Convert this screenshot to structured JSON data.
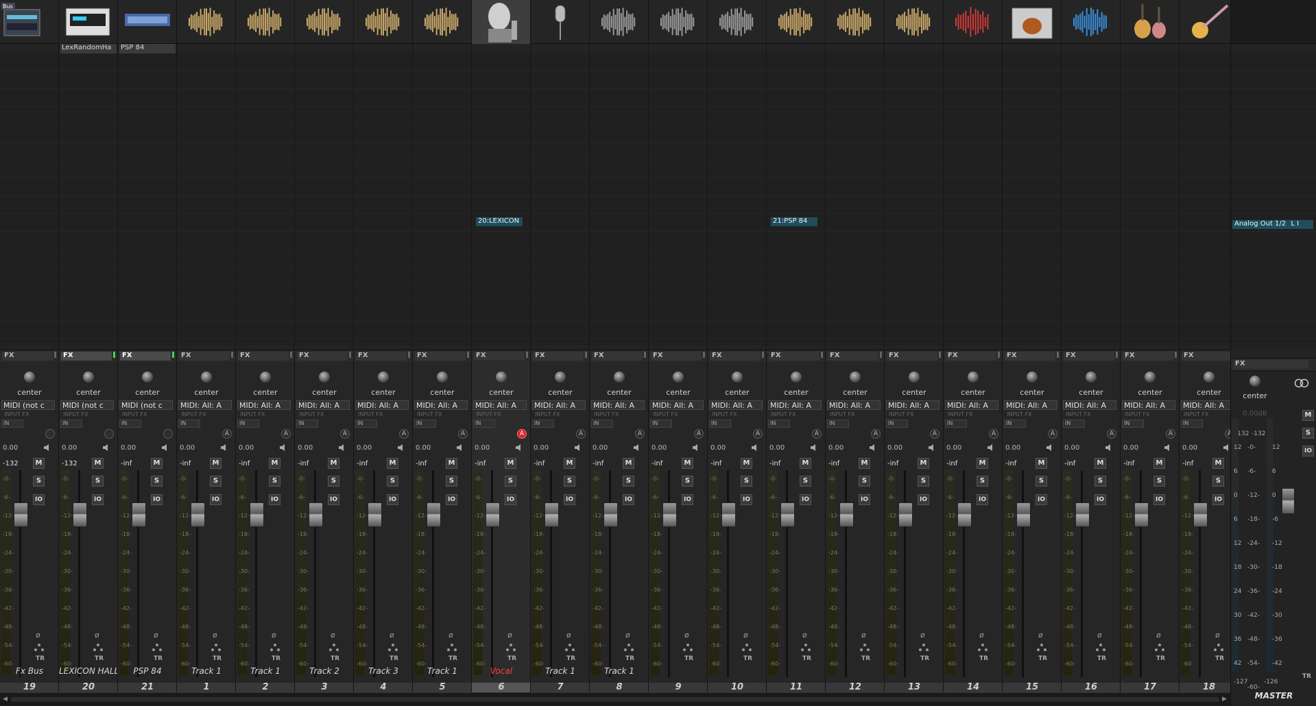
{
  "tracks": [
    {
      "num": "19",
      "name": "Fx Bus",
      "pan": "center",
      "input": "MIDI (not c",
      "volume": "0.00",
      "peak": "-132",
      "fx_on": false,
      "fx_led": false,
      "icon": "rack-device-icon",
      "send": "",
      "arm": "none",
      "selected": false,
      "tab": ""
    },
    {
      "num": "20",
      "name": "LEXICON HALL",
      "pan": "center",
      "input": "MIDI (not c",
      "volume": "0.00",
      "peak": "-132",
      "fx_on": true,
      "fx_led": true,
      "icon": "lexicon-hardware-icon",
      "send": "",
      "arm": "none",
      "selected": false,
      "tab": "LexRandomHa"
    },
    {
      "num": "21",
      "name": "PSP 84",
      "pan": "center",
      "input": "MIDI (not c",
      "volume": "0.00",
      "peak": "-inf",
      "fx_on": true,
      "fx_led": true,
      "icon": "psp84-plugin-icon",
      "send": "",
      "arm": "none",
      "selected": false,
      "tab": "PSP 84"
    },
    {
      "num": "1",
      "name": "Track 1",
      "pan": "center",
      "input": "MIDI: All: A",
      "volume": "0.00",
      "peak": "-inf",
      "fx_on": false,
      "fx_led": false,
      "icon": "gold-waveform-icon",
      "send": "",
      "arm": "A",
      "selected": false,
      "tab": ""
    },
    {
      "num": "2",
      "name": "Track 1",
      "pan": "center",
      "input": "MIDI: All: A",
      "volume": "0.00",
      "peak": "-inf",
      "fx_on": false,
      "fx_led": false,
      "icon": "gold-waveform-icon",
      "send": "",
      "arm": "A",
      "selected": false,
      "tab": ""
    },
    {
      "num": "3",
      "name": "Track 2",
      "pan": "center",
      "input": "MIDI: All: A",
      "volume": "0.00",
      "peak": "-inf",
      "fx_on": false,
      "fx_led": false,
      "icon": "gold-waveform-icon",
      "send": "",
      "arm": "A",
      "selected": false,
      "tab": ""
    },
    {
      "num": "4",
      "name": "Track 3",
      "pan": "center",
      "input": "MIDI: All: A",
      "volume": "0.00",
      "peak": "-inf",
      "fx_on": false,
      "fx_led": false,
      "icon": "gold-waveform-icon",
      "send": "",
      "arm": "A",
      "selected": false,
      "tab": ""
    },
    {
      "num": "5",
      "name": "Track 1",
      "pan": "center",
      "input": "MIDI: All: A",
      "volume": "0.00",
      "peak": "-inf",
      "fx_on": false,
      "fx_led": false,
      "icon": "gold-waveform-icon",
      "send": "",
      "arm": "A",
      "selected": false,
      "tab": ""
    },
    {
      "num": "6",
      "name": "Vocal",
      "pan": "center",
      "input": "MIDI: All: A",
      "volume": "0.00",
      "peak": "-inf",
      "fx_on": false,
      "fx_led": false,
      "icon": "singer-portrait-icon",
      "send": "20:LEXICON",
      "arm": "on",
      "selected": true,
      "tab": ""
    },
    {
      "num": "7",
      "name": "Track 1",
      "pan": "center",
      "input": "MIDI: All: A",
      "volume": "0.00",
      "peak": "-inf",
      "fx_on": false,
      "fx_led": false,
      "icon": "microphone-icon",
      "send": "",
      "arm": "A",
      "selected": false,
      "tab": ""
    },
    {
      "num": "8",
      "name": "Track 1",
      "pan": "center",
      "input": "MIDI: All: A",
      "volume": "0.00",
      "peak": "-inf",
      "fx_on": false,
      "fx_led": false,
      "icon": "gray-waveform-icon",
      "send": "",
      "arm": "A",
      "selected": false,
      "tab": ""
    },
    {
      "num": "9",
      "name": "",
      "pan": "center",
      "input": "MIDI: All: A",
      "volume": "0.00",
      "peak": "-inf",
      "fx_on": false,
      "fx_led": false,
      "icon": "gray-waveform-icon",
      "send": "",
      "arm": "A",
      "selected": false,
      "tab": ""
    },
    {
      "num": "10",
      "name": "",
      "pan": "center",
      "input": "MIDI: All: A",
      "volume": "0.00",
      "peak": "-inf",
      "fx_on": false,
      "fx_led": false,
      "icon": "gray-waveform-icon",
      "send": "",
      "arm": "A",
      "selected": false,
      "tab": ""
    },
    {
      "num": "11",
      "name": "",
      "pan": "center",
      "input": "MIDI: All: A",
      "volume": "0.00",
      "peak": "-inf",
      "fx_on": false,
      "fx_led": false,
      "icon": "gold-waveform-icon",
      "send": "21:PSP 84",
      "arm": "A",
      "selected": false,
      "tab": ""
    },
    {
      "num": "12",
      "name": "",
      "pan": "center",
      "input": "MIDI: All: A",
      "volume": "0.00",
      "peak": "-inf",
      "fx_on": false,
      "fx_led": false,
      "icon": "gold-waveform-icon",
      "send": "",
      "arm": "A",
      "selected": false,
      "tab": ""
    },
    {
      "num": "13",
      "name": "",
      "pan": "center",
      "input": "MIDI: All: A",
      "volume": "0.00",
      "peak": "-inf",
      "fx_on": false,
      "fx_led": false,
      "icon": "gold-waveform-icon",
      "send": "",
      "arm": "A",
      "selected": false,
      "tab": ""
    },
    {
      "num": "14",
      "name": "",
      "pan": "center",
      "input": "MIDI: All: A",
      "volume": "0.00",
      "peak": "-inf",
      "fx_on": false,
      "fx_led": false,
      "icon": "red-waveform-icon",
      "send": "",
      "arm": "A",
      "selected": false,
      "tab": ""
    },
    {
      "num": "15",
      "name": "",
      "pan": "center",
      "input": "MIDI: All: A",
      "volume": "0.00",
      "peak": "-inf",
      "fx_on": false,
      "fx_led": false,
      "icon": "guitar-folder-icon",
      "send": "",
      "arm": "A",
      "selected": false,
      "tab": ""
    },
    {
      "num": "16",
      "name": "",
      "pan": "center",
      "input": "MIDI: All: A",
      "volume": "0.00",
      "peak": "-inf",
      "fx_on": false,
      "fx_led": false,
      "icon": "blue-waveform-icon",
      "send": "",
      "arm": "A",
      "selected": false,
      "tab": ""
    },
    {
      "num": "17",
      "name": "",
      "pan": "center",
      "input": "MIDI: All: A",
      "volume": "0.00",
      "peak": "-inf",
      "fx_on": false,
      "fx_led": false,
      "icon": "acoustic-guitars-icon",
      "send": "",
      "arm": "A",
      "selected": false,
      "tab": ""
    },
    {
      "num": "18",
      "name": "",
      "pan": "center",
      "input": "MIDI: All: A",
      "volume": "0.00",
      "peak": "-inf",
      "fx_on": false,
      "fx_led": false,
      "icon": "electric-guitar-icon",
      "send": "",
      "arm": "A",
      "selected": false,
      "tab": ""
    }
  ],
  "labels": {
    "fx": "FX",
    "input_fx": "INPUT FX",
    "in": "IN",
    "mute": "M",
    "solo": "S",
    "fx_bypass": "IO",
    "tr": "TR",
    "arm": "A",
    "phase": "ø",
    "bus_badge": "Bus"
  },
  "meter_scale": [
    "-0-",
    "-6-",
    "-12-",
    "-18-",
    "-24-",
    "-30-",
    "-36-",
    "-42-",
    "-48-",
    "-54-",
    "-60-"
  ],
  "master": {
    "name": "MASTER",
    "pan": "center",
    "volume": "0.00dB",
    "output": "Analog Out 1/2",
    "output_suffix": "L I",
    "peak_left": "-132",
    "peak_right": "-132",
    "bottom_left": "-127",
    "bottom_right": "-126",
    "left_scale": [
      "12",
      "6",
      "0",
      "6",
      "12",
      "18",
      "24",
      "30",
      "36",
      "42"
    ],
    "right_scale": [
      "12",
      "6",
      "0",
      "-6",
      "-12",
      "-18",
      "-24",
      "-30",
      "-36",
      "-42"
    ],
    "inner_scale": [
      "-0-",
      "-6-",
      "-12-",
      "-18-",
      "-24-",
      "-30-",
      "-36-",
      "-42-",
      "-48-",
      "-54-",
      "-60-"
    ]
  },
  "colors": {
    "armed": "#d42626",
    "send_box": "#1f4d5c",
    "selected_name": "#ff4040",
    "fx_led": "#4cd34c"
  }
}
